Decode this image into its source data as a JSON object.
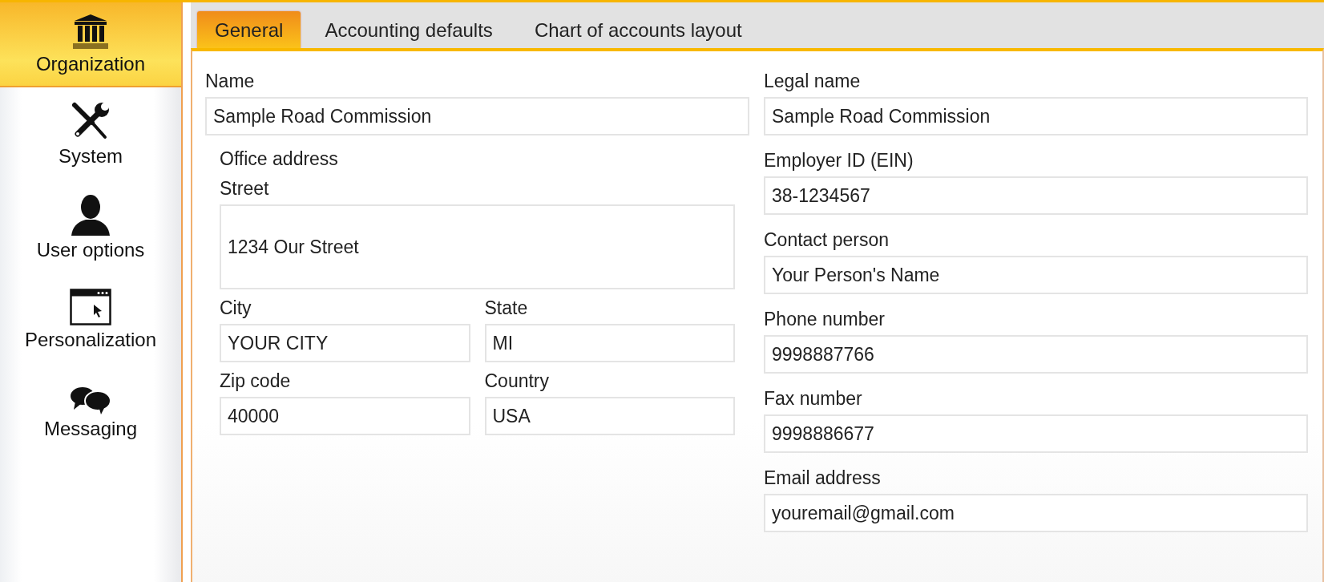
{
  "sidebar": {
    "items": [
      {
        "label": "Organization",
        "selected": true
      },
      {
        "label": "System",
        "selected": false
      },
      {
        "label": "User options",
        "selected": false
      },
      {
        "label": "Personalization",
        "selected": false
      },
      {
        "label": "Messaging",
        "selected": false
      }
    ]
  },
  "tabs": [
    {
      "label": "General",
      "selected": true
    },
    {
      "label": "Accounting defaults",
      "selected": false
    },
    {
      "label": "Chart of accounts layout",
      "selected": false
    }
  ],
  "form": {
    "name": {
      "label": "Name",
      "value": "Sample Road Commission"
    },
    "office_address": {
      "heading": "Office address",
      "street": {
        "label": "Street",
        "value": "1234 Our Street"
      },
      "city": {
        "label": "City",
        "value": "YOUR CITY"
      },
      "state": {
        "label": "State",
        "value": "MI"
      },
      "zip": {
        "label": "Zip code",
        "value": "40000"
      },
      "country": {
        "label": "Country",
        "value": "USA"
      }
    },
    "right_fields": [
      {
        "label": "Legal name",
        "value": "Sample Road Commission"
      },
      {
        "label": "Employer ID (EIN)",
        "value": "38-1234567"
      },
      {
        "label": "Contact person",
        "value": "Your Person's Name"
      },
      {
        "label": "Phone number",
        "value": "9998887766"
      },
      {
        "label": "Fax number",
        "value": "9998886677"
      },
      {
        "label": "Email address",
        "value": "youremail@gmail.com"
      }
    ]
  }
}
